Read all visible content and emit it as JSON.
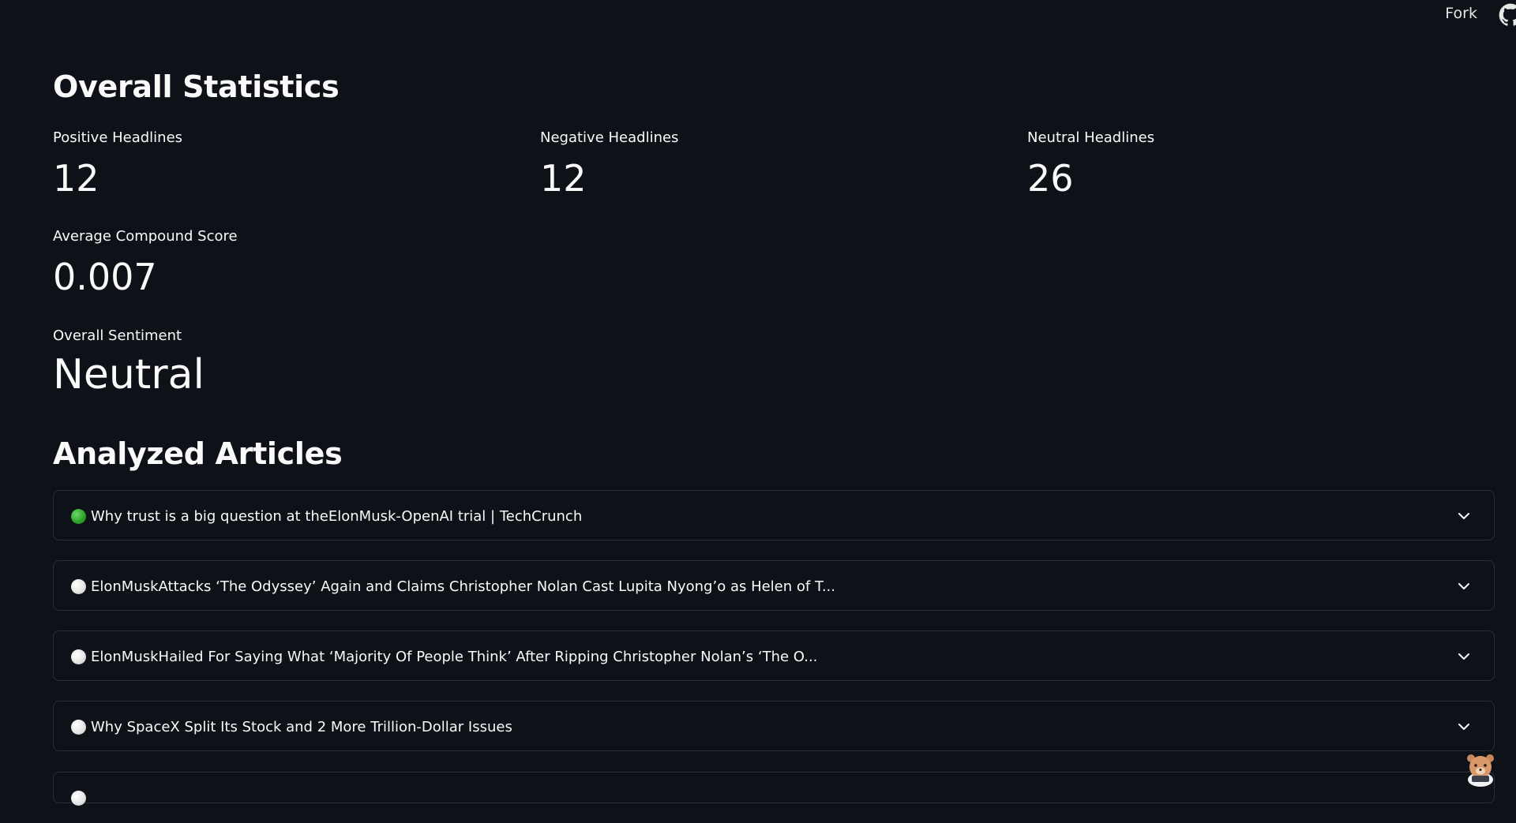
{
  "header": {
    "fork_label": "Fork",
    "github_icon": "github-icon"
  },
  "stats": {
    "title": "Overall Statistics",
    "positive": {
      "label": "Positive Headlines",
      "value": "12"
    },
    "negative": {
      "label": "Negative Headlines",
      "value": "12"
    },
    "neutral": {
      "label": "Neutral Headlines",
      "value": "26"
    },
    "average": {
      "label": "Average Compound Score",
      "value": "0.007"
    },
    "overall": {
      "label": "Overall Sentiment",
      "value": "Neutral"
    }
  },
  "articles": {
    "title": "Analyzed Articles",
    "items": [
      {
        "sentiment": "positive",
        "dot_color": "#2fa52c",
        "title": "Why trust is a big question at theElonMusk-OpenAI trial | TechCrunch"
      },
      {
        "sentiment": "neutral",
        "dot_color": "#e6e6e6",
        "title": "ElonMuskAttacks ‘The Odyssey’ Again and Claims Christopher Nolan Cast Lupita Nyong’o as Helen of T..."
      },
      {
        "sentiment": "neutral",
        "dot_color": "#e6e6e6",
        "title": "ElonMuskHailed For Saying What ‘Majority Of People Think’ After Ripping Christopher Nolan’s ‘The O..."
      },
      {
        "sentiment": "neutral",
        "dot_color": "#e6e6e6",
        "title": "Why SpaceX Split Its Stock and 2 More Trillion-Dollar Issues"
      },
      {
        "sentiment": "neutral",
        "dot_color": "#e6e6e6",
        "title": ""
      }
    ]
  },
  "colors": {
    "background": "#0e1117",
    "text": "#fafafa",
    "border": "#2b2e36",
    "positive": "#2fa52c",
    "neutral": "#e6e6e6"
  }
}
